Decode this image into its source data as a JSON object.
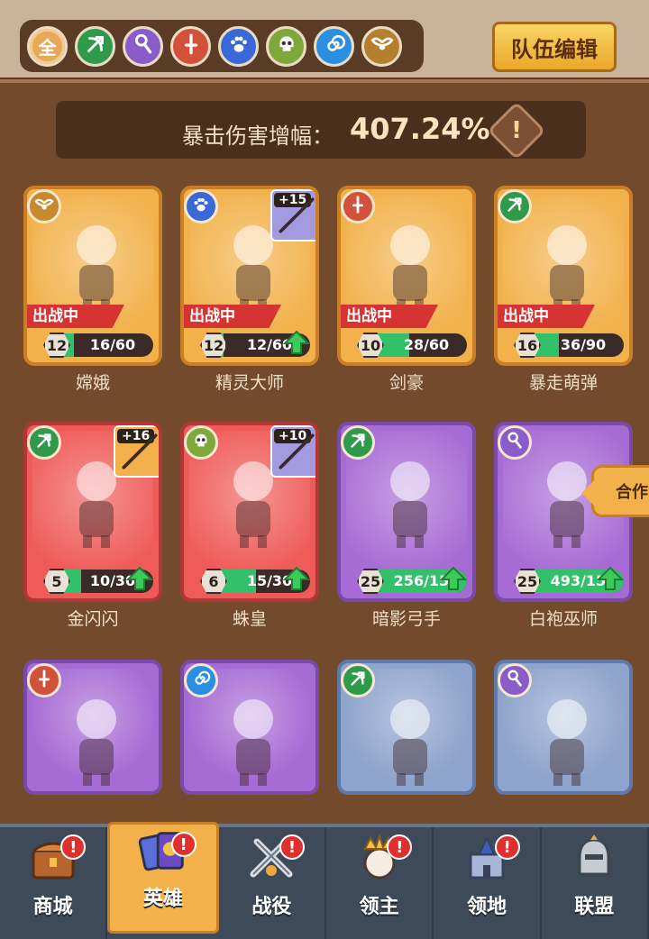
{
  "filters": [
    {
      "name": "all",
      "label": "全",
      "color": "#e8a85a",
      "active": true
    },
    {
      "name": "ranger",
      "icon": "bow-icon",
      "color": "#2e9a4a"
    },
    {
      "name": "mage",
      "icon": "staff-icon",
      "color": "#8a5cc9"
    },
    {
      "name": "warrior",
      "icon": "sword-icon",
      "color": "#d2513a"
    },
    {
      "name": "beast",
      "icon": "paw-icon",
      "color": "#3b68d8"
    },
    {
      "name": "undead",
      "icon": "skull-icon",
      "color": "#7fa83a"
    },
    {
      "name": "spirit",
      "icon": "swirl-icon",
      "color": "#2a8fe0"
    },
    {
      "name": "divine",
      "icon": "wings-icon",
      "color": "#b4802e"
    }
  ],
  "team_button": "队伍编辑",
  "crit": {
    "label": "暴击伤害增幅：",
    "value": "407.24%",
    "info_glyph": "!"
  },
  "heroes": [
    {
      "name": "嫦娥",
      "rarity": "gold",
      "class_icon": "wings-icon",
      "class_color": "#c78a2e",
      "in_battle": "出战中",
      "level": "12",
      "progress": "16/60",
      "progress_fraction": 0.27,
      "upgrade": false,
      "weapon_plus": ""
    },
    {
      "name": "精灵大师",
      "rarity": "gold",
      "class_icon": "paw-icon",
      "class_color": "#3b68d8",
      "in_battle": "出战中",
      "level": "12",
      "progress": "12/60",
      "progress_fraction": 0.2,
      "upgrade": true,
      "weapon_plus": "+15"
    },
    {
      "name": "剑豪",
      "rarity": "gold",
      "class_icon": "sword-icon",
      "class_color": "#d2513a",
      "in_battle": "出战中",
      "level": "10",
      "progress": "28/60",
      "progress_fraction": 0.47,
      "upgrade": false,
      "weapon_plus": ""
    },
    {
      "name": "暴走萌弹",
      "rarity": "gold",
      "class_icon": "bow-icon",
      "class_color": "#2e9a4a",
      "in_battle": "出战中",
      "level": "16",
      "progress": "36/90",
      "progress_fraction": 0.4,
      "upgrade": false,
      "weapon_plus": ""
    },
    {
      "name": "金闪闪",
      "rarity": "red",
      "class_icon": "bow-icon",
      "class_color": "#2e9a4a",
      "in_battle": "",
      "level": "5",
      "progress": "10/30",
      "progress_fraction": 0.33,
      "upgrade": true,
      "weapon_plus": "+16"
    },
    {
      "name": "蛛皇",
      "rarity": "red",
      "class_icon": "skull-icon",
      "class_color": "#7fa83a",
      "in_battle": "",
      "level": "6",
      "progress": "15/30",
      "progress_fraction": 0.5,
      "upgrade": true,
      "weapon_plus": "+10"
    },
    {
      "name": "暗影弓手",
      "rarity": "purple",
      "class_icon": "bow-icon",
      "class_color": "#2e9a4a",
      "in_battle": "",
      "level": "25",
      "progress": "256/150",
      "progress_fraction": 1.0,
      "upgrade": true,
      "weapon_plus": ""
    },
    {
      "name": "白袍巫师",
      "rarity": "purple",
      "class_icon": "staff-icon",
      "class_color": "#8a5cc9",
      "in_battle": "",
      "level": "25",
      "progress": "493/150",
      "progress_fraction": 1.0,
      "upgrade": true,
      "weapon_plus": ""
    },
    {
      "name": "",
      "rarity": "purple",
      "class_icon": "sword-icon",
      "class_color": "#d2513a",
      "in_battle": "",
      "level": "",
      "progress": "",
      "progress_fraction": 0,
      "upgrade": false,
      "weapon_plus": ""
    },
    {
      "name": "",
      "rarity": "purple",
      "class_icon": "swirl-icon",
      "class_color": "#2a8fe0",
      "in_battle": "",
      "level": "",
      "progress": "",
      "progress_fraction": 0,
      "upgrade": false,
      "weapon_plus": ""
    },
    {
      "name": "",
      "rarity": "blue",
      "class_icon": "bow-icon",
      "class_color": "#2e9a4a",
      "in_battle": "",
      "level": "",
      "progress": "",
      "progress_fraction": 0,
      "upgrade": false,
      "weapon_plus": ""
    },
    {
      "name": "",
      "rarity": "blue",
      "class_icon": "staff-icon",
      "class_color": "#8a5cc9",
      "in_battle": "",
      "level": "",
      "progress": "",
      "progress_fraction": 0,
      "upgrade": false,
      "weapon_plus": ""
    }
  ],
  "merge_tab": "合作",
  "nav": [
    {
      "label": "商城",
      "icon": "shop-chest-icon",
      "alert": "!",
      "active": false
    },
    {
      "label": "英雄",
      "icon": "hero-cards-icon",
      "alert": "!",
      "active": true
    },
    {
      "label": "战役",
      "icon": "crossed-swords-icon",
      "alert": "!",
      "active": false
    },
    {
      "label": "领主",
      "icon": "crowned-lord-icon",
      "alert": "!",
      "active": false
    },
    {
      "label": "领地",
      "icon": "castle-icon",
      "alert": "!",
      "active": false
    },
    {
      "label": "联盟",
      "icon": "knight-helmet-icon",
      "alert": "",
      "active": false
    }
  ]
}
